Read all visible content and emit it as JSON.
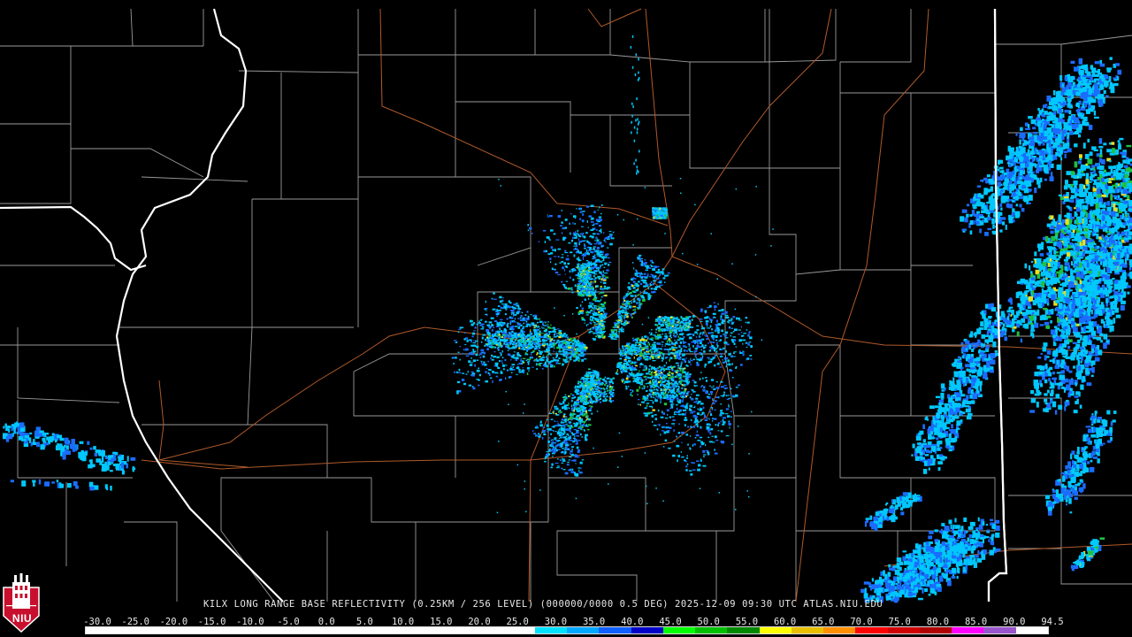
{
  "product_caption": "KILX LONG RANGE BASE REFLECTIVITY (0.25KM / 256 LEVEL) (000000/0000 0.5 DEG) 2025-12-09 09:30 UTC  ATLAS.NIU.EDU",
  "logo": {
    "text": "NIU"
  },
  "colorbar": {
    "tick_labels": [
      "-30.0",
      "-25.0",
      "-20.0",
      "-15.0",
      "-10.0",
      "-5.0",
      "0.0",
      "5.0",
      "10.0",
      "15.0",
      "20.0",
      "25.0",
      "30.0",
      "35.0",
      "40.0",
      "45.0",
      "50.0",
      "55.0",
      "60.0",
      "65.0",
      "70.0",
      "75.0",
      "80.0",
      "85.0",
      "90.0",
      "94.5"
    ],
    "colors": [
      "#ffffff",
      "#ffffff",
      "#ffffff",
      "#ffffff",
      "#ffffff",
      "#ffffff",
      "#ffffff",
      "#ffffff",
      "#ffffff",
      "#ffffff",
      "#ffffff",
      "#ffffff",
      "#ffffff",
      "#ffffff",
      "#00e0ff",
      "#00a8ff",
      "#1060ff",
      "#0000c8",
      "#00ff00",
      "#00c000",
      "#008800",
      "#ffff00",
      "#e8c000",
      "#ff9000",
      "#ff0000",
      "#d00000",
      "#b00000",
      "#ff00ff",
      "#9955cc",
      "#ffffff"
    ]
  },
  "colors": {
    "background": "#000000",
    "county_lines": "#9a9a9a",
    "state_lines": "#ffffff",
    "highways": "#b05a2a",
    "echo_light": "#00c8ff",
    "echo_medium": "#1a6cff",
    "echo_strong": "#20c040",
    "echo_peak": "#e8e020"
  }
}
